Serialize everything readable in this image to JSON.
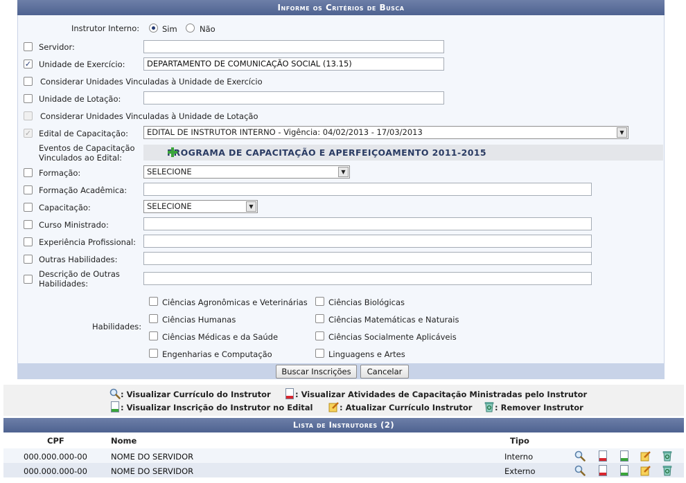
{
  "form": {
    "title": "Informe os Critérios de Busca",
    "instrutor_interno": {
      "label": "Instrutor Interno:",
      "options": [
        "Sim",
        "Não"
      ],
      "selected": "Sim"
    },
    "servidor": {
      "label": "Servidor:",
      "value": "",
      "checked": false
    },
    "unidade_exercicio": {
      "label": "Unidade de Exercício:",
      "value": "DEPARTAMENTO DE COMUNICAÇÃO SOCIAL (13.15)",
      "checked": true
    },
    "considerar_exercicio": {
      "label": "Considerar Unidades Vinculadas à Unidade de Exercício",
      "checked": false
    },
    "unidade_lotacao": {
      "label": "Unidade de Lotação:",
      "value": "",
      "checked": false
    },
    "considerar_lotacao": {
      "label": "Considerar Unidades Vinculadas à Unidade de Lotação",
      "checked": false,
      "disabled": true
    },
    "edital": {
      "label": "Edital de Capacitação:",
      "value": "EDITAL DE INSTRUTOR INTERNO - Vigência: 04/02/2013 - 17/03/2013",
      "checked": true,
      "disabled": true
    },
    "eventos": {
      "label_line1": "Eventos de Capacitação",
      "label_line2": "Vinculados ao Edital:",
      "program": "PROGRAMA DE CAPACITAÇÃO E APERFEIÇOAMENTO 2011-2015"
    },
    "formacao": {
      "label": "Formação:",
      "value": "SELECIONE"
    },
    "formacao_academica": {
      "label": "Formação Acadêmica:",
      "value": ""
    },
    "capacitacao": {
      "label": "Capacitação:",
      "value": "SELECIONE"
    },
    "curso_ministrado": {
      "label": "Curso Ministrado:",
      "value": ""
    },
    "experiencia": {
      "label": "Experiência Profissional:",
      "value": ""
    },
    "outras_habilidades": {
      "label": "Outras Habilidades:",
      "value": ""
    },
    "descricao_outras": {
      "label_line1": "Descrição de Outras",
      "label_line2": "Habilidades:",
      "value": ""
    },
    "habilidades": {
      "label": "Habilidades:",
      "items": [
        "Ciências Agronômicas e Veterinárias",
        "Ciências Biológicas",
        "Ciências Humanas",
        "Ciências Matemáticas e Naturais",
        "Ciências Médicas e da Saúde",
        "Ciências Socialmente Aplicáveis",
        "Engenharias e Computação",
        "Linguagens e Artes"
      ]
    },
    "buttons": {
      "search": "Buscar Inscrições",
      "cancel": "Cancelar"
    }
  },
  "legend": {
    "view_curriculum": ": Visualizar Currículo do Instrutor",
    "view_activities": ": Visualizar Atividades de Capacitação Ministradas pelo Instrutor",
    "view_registration": ": Visualizar Inscrição do Instrutor no Edital",
    "update_curriculum": ": Atualizar Currículo Instrutor",
    "remove_instructor": ": Remover Instrutor"
  },
  "list": {
    "title": "Lista de Instrutores (2)",
    "columns": [
      "CPF",
      "Nome",
      "Tipo"
    ],
    "rows": [
      {
        "cpf": "000.000.000-00",
        "nome": "NOME DO SERVIDOR",
        "tipo": "Interno"
      },
      {
        "cpf": "000.000.000-00",
        "nome": "NOME DO SERVIDOR",
        "tipo": "Externo"
      }
    ]
  },
  "colors": {
    "header": "#4e6290",
    "accent_green": "#3aa53a"
  }
}
